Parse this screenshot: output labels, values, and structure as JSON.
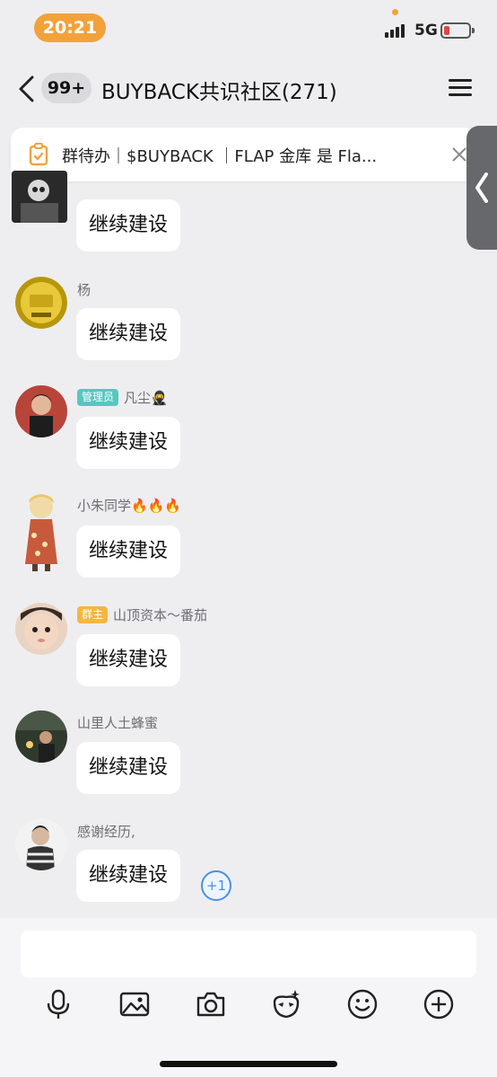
{
  "status_bar": {
    "time": "20:21",
    "network": "5G"
  },
  "header": {
    "unread_count": "99+",
    "title": "BUYBACK共识社区(271)"
  },
  "notice": {
    "text": "群待办｜$BUYBACK ｜FLAP 金库 是 Fla..."
  },
  "messages": [
    {
      "sender": "",
      "text": "继续建设"
    },
    {
      "sender": "杨",
      "text": "继续建设"
    },
    {
      "sender": "凡尘🥷",
      "role": "管理员",
      "text": "继续建设"
    },
    {
      "sender": "小朱同学🔥🔥🔥",
      "text": "继续建设"
    },
    {
      "sender": "山顶资本～番茄",
      "role": "群主",
      "text": "继续建设"
    },
    {
      "sender": "山里人土蜂蜜",
      "text": "继续建设"
    },
    {
      "sender": "感谢经历,",
      "text": "继续建设",
      "reaction": "+1"
    }
  ],
  "input": {
    "placeholder": ""
  },
  "toolbar": [
    "microphone-icon",
    "image-icon",
    "camera-icon",
    "sticker-icon",
    "emoji-icon",
    "plus-icon"
  ]
}
